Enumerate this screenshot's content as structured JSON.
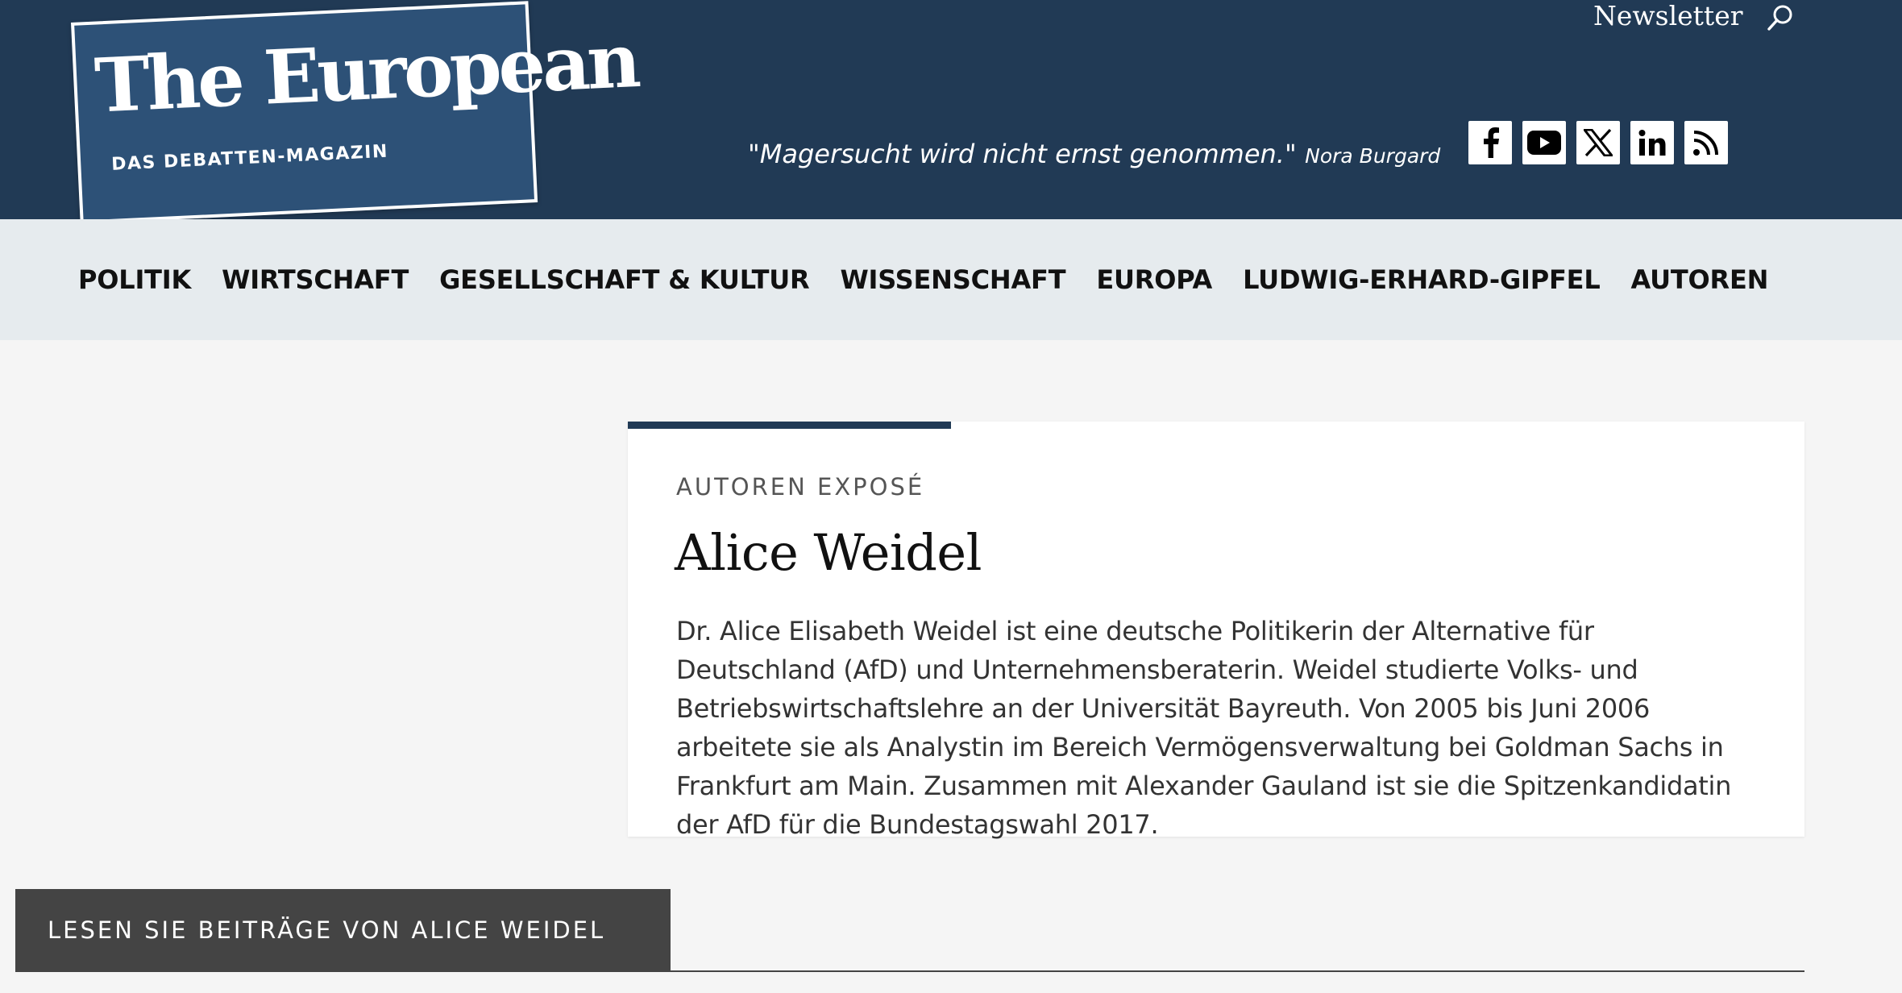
{
  "header": {
    "logo_title": "The European",
    "logo_subtitle": "DAS DEBATTEN-MAGAZIN",
    "newsletter_label": "Newsletter",
    "quote_text": "\"Magersucht wird nicht ernst genommen.\"",
    "quote_author": "Nora Burgard",
    "social_icons": [
      "facebook-icon",
      "youtube-icon",
      "x-icon",
      "linkedin-icon",
      "rss-icon"
    ]
  },
  "nav": {
    "items": [
      "POLITIK",
      "WIRTSCHAFT",
      "GESELLSCHAFT & KULTUR",
      "WISSENSCHAFT",
      "EUROPA",
      "LUDWIG-ERHARD-GIPFEL",
      "AUTOREN"
    ]
  },
  "author": {
    "kicker": "AUTOREN EXPOSÉ",
    "name": "Alice Weidel",
    "bio": "Dr. Alice Elisabeth Weidel ist eine deutsche Politikerin der Alternative für Deutschland (AfD) und Unternehmensberaterin. Weidel studierte Volks- und Betriebswirtschaftslehre an der Universität Bayreuth. Von 2005 bis Juni 2006 arbeitete sie als Analystin im Bereich Vermögensverwaltung bei Goldman Sachs in Frankfurt am Main. Zusammen mit Alexander Gauland ist sie die Spitzenkandidatin der AfD für die Bundestagswahl 2017."
  },
  "articles": {
    "tab_label": "LESEN SIE BEITRÄGE VON ALICE WEIDEL"
  },
  "colors": {
    "header_bg": "#213a55",
    "logo_bg": "#2d5177",
    "nav_bg": "#e6ebee",
    "page_bg": "#f5f5f5",
    "tab_bg": "#444444"
  }
}
